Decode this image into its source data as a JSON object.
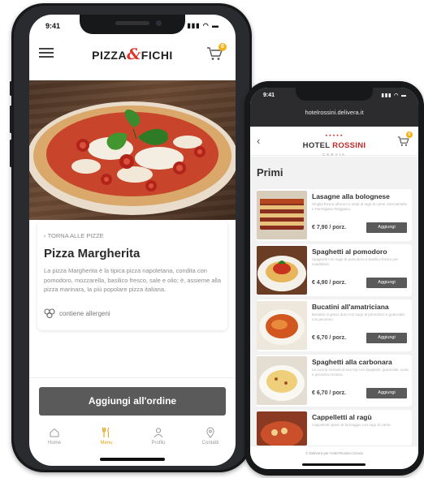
{
  "phone_main": {
    "status_time": "9:41",
    "brand": {
      "left": "PIZZA",
      "amp": "&",
      "right": "FICHI"
    },
    "cart_count": "0",
    "back_link": "TORNA ALLE PIZZE",
    "product": {
      "title": "Pizza Margherita",
      "description": "La pizza Margherita è la tipica pizza napoletana, condita con pomodoro, mozzarella, basilico fresco, sale e olio; è, assieme alla pizza marinara, la più popolare pizza italiana.",
      "allergens_label": "contiene allergeni"
    },
    "add_button": "Aggiungi all'ordine",
    "tabs": [
      {
        "label": "Home",
        "icon": "home-icon"
      },
      {
        "label": "Menu",
        "icon": "cutlery-icon"
      },
      {
        "label": "Profilo",
        "icon": "user-icon"
      },
      {
        "label": "Contatti",
        "icon": "location-icon"
      }
    ],
    "active_tab": "Menu",
    "colors": {
      "accent": "#e9a21b",
      "brand_red": "#e0342a",
      "button": "#5a5a5a"
    }
  },
  "phone_secondary": {
    "status_time": "9:41",
    "url": "hotelrossini.delivera.it",
    "brand": {
      "stars": "★★★★★",
      "prefix": "HOTEL",
      "name": "ROSSINI",
      "city": "CERVIA"
    },
    "cart_count": "0",
    "section_title": "Primi",
    "items": [
      {
        "name": "Lasagne alla bolognese",
        "description": "Sfoglia fresca all'uovo e strati di ragù di carne, besciamella e Parmigiano Reggiano.",
        "price": "€ 7,90 / porz.",
        "button": "Aggiungi"
      },
      {
        "name": "Spaghetti al pomodoro",
        "description": "Spaghetti con sugo di pomodoro e basilico fresco per soddisfare.",
        "price": "€ 4,90 / porz.",
        "button": "Aggiungi"
      },
      {
        "name": "Bucatini all'amatriciana",
        "description": "Bucatini di grano duro con sugo al pomodoro e guanciale, con pecorino.",
        "price": "€ 6,70 / porz.",
        "button": "Aggiungi"
      },
      {
        "name": "Spaghetti alla carbonara",
        "description": "La cucina romana al suo top con spaghetti, guanciale, uova e pecorino romano.",
        "price": "€ 6,70 / porz.",
        "button": "Aggiungi"
      },
      {
        "name": "Cappelletti al ragù",
        "description": "Cappelletti ripieni al formaggio con ragù di carne.",
        "price": "",
        "button": ""
      }
    ],
    "footer": "© Delivera per Hotel Rossini Cervia"
  }
}
